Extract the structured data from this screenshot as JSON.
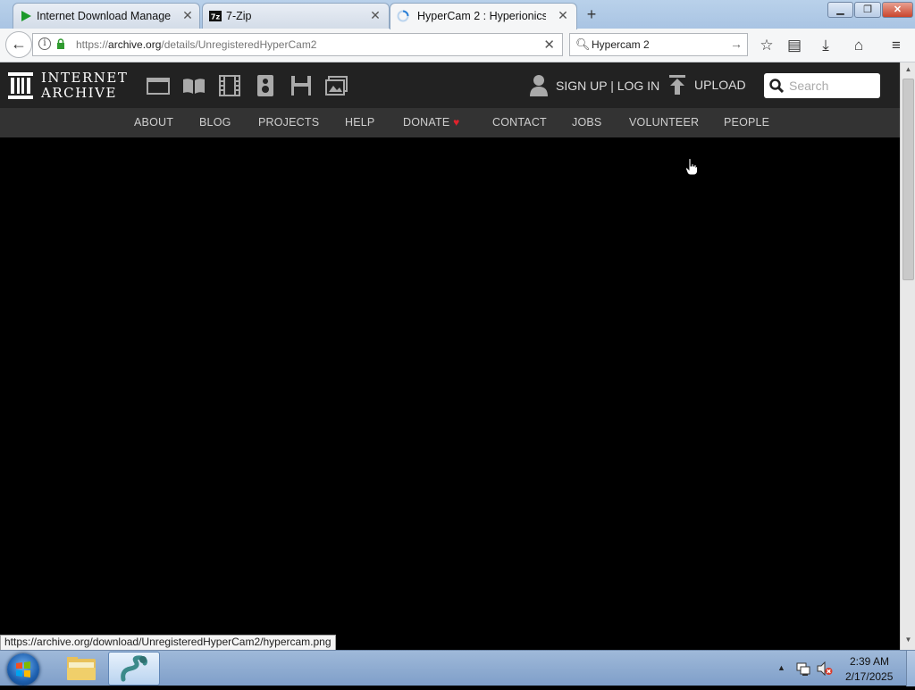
{
  "browser": {
    "tabs": [
      {
        "title": "Internet Download Manager"
      },
      {
        "title": "7-Zip"
      },
      {
        "title": "HyperCam 2 : Hyperionics :"
      }
    ],
    "url_prefix": "https://",
    "url_domain": "archive.org",
    "url_path": "/details/UnregisteredHyperCam2",
    "search_value": "Hypercam 2",
    "status_text": "https://archive.org/download/UnregisteredHyperCam2/hypercam.png"
  },
  "site": {
    "logo_line1": "INTERNET",
    "logo_line2": "ARCHIVE",
    "signup": "SIGN UP | LOG IN",
    "upload": "UPLOAD",
    "search_placeholder": "Search",
    "nav": [
      "ABOUT",
      "BLOG",
      "PROJECTS",
      "HELP",
      "DONATE",
      "CONTACT",
      "JOBS",
      "VOLUNTEER",
      "PEOPLE"
    ],
    "donate_heart": "♥"
  },
  "taskbar": {
    "time": "2:39 AM",
    "date": "2/17/2025"
  },
  "icons": [
    "back-arrow-icon",
    "info-icon",
    "lock-icon",
    "search-icon",
    "star-icon",
    "reader-icon",
    "download-icon",
    "home-icon",
    "menu-icon",
    "archive-logo-icon",
    "web-icon",
    "book-icon",
    "film-icon",
    "audio-icon",
    "software-icon",
    "image-icon",
    "user-icon",
    "upload-icon",
    "hand-cursor-icon",
    "windows-start-icon",
    "folder-icon",
    "snake-app-icon",
    "network-icon",
    "volume-muted-icon"
  ],
  "colors": {
    "ia_header": "#222222",
    "ia_nav": "#333333",
    "donate_heart": "#e0222c",
    "content": "#000000"
  }
}
